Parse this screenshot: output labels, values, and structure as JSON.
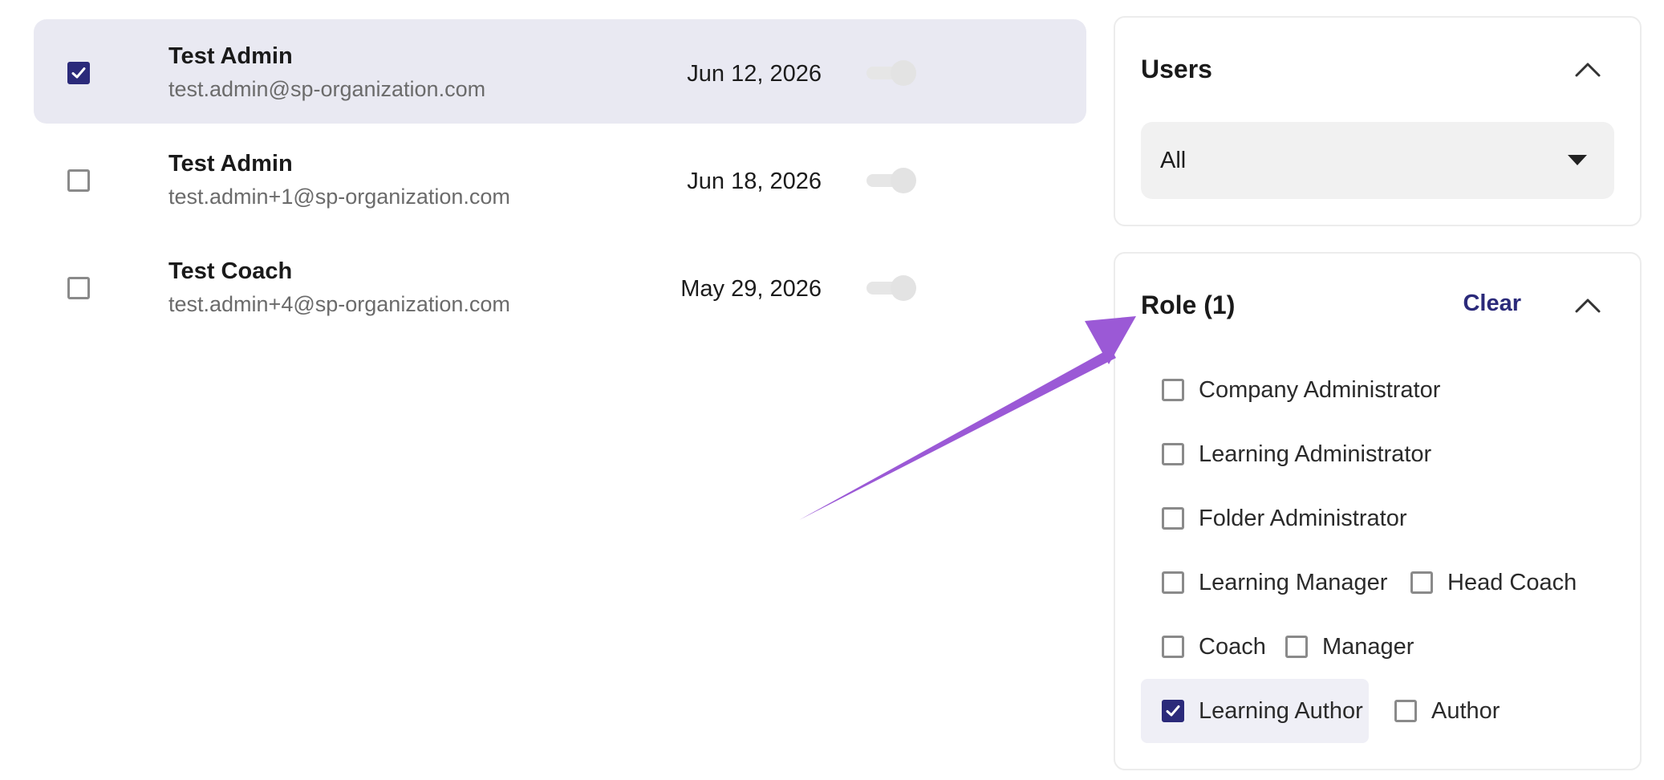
{
  "users": [
    {
      "name": "Test Admin",
      "email": "test.admin@sp-organization.com",
      "date": "Jun 12, 2026",
      "checked": true
    },
    {
      "name": "Test Admin",
      "email": "test.admin+1@sp-organization.com",
      "date": "Jun 18, 2026",
      "checked": false
    },
    {
      "name": "Test Coach",
      "email": "test.admin+4@sp-organization.com",
      "date": "May 29, 2026",
      "checked": false
    }
  ],
  "users_filter": {
    "title": "Users",
    "selected": "All"
  },
  "role_filter": {
    "title": "Role (1)",
    "clear_label": "Clear",
    "options": [
      {
        "label": "Company Administrator",
        "checked": false
      },
      {
        "label": "Learning Administrator",
        "checked": false
      },
      {
        "label": "Folder Administrator",
        "checked": false
      },
      {
        "label": "Learning Manager",
        "checked": false
      },
      {
        "label": "Head Coach",
        "checked": false
      },
      {
        "label": "Coach",
        "checked": false
      },
      {
        "label": "Manager",
        "checked": false
      },
      {
        "label": "Learning Author",
        "checked": true
      },
      {
        "label": "Author",
        "checked": false
      }
    ]
  },
  "colors": {
    "accent": "#2b2a7a",
    "selected_row": "#e9e9f2",
    "annotation_arrow": "#9b59d6"
  },
  "icons": {
    "checkbox_checked": "check-icon",
    "collapse": "chevron-up-icon",
    "dropdown": "caret-down-icon"
  }
}
